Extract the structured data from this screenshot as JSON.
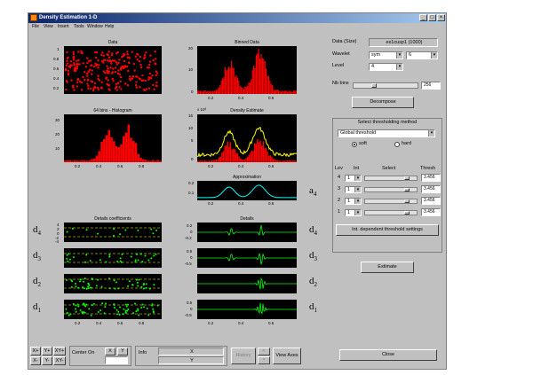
{
  "window": {
    "title": "Density Estimation 1-D"
  },
  "menus": [
    "File",
    "View",
    "Insert",
    "Tools",
    "Window",
    "Help"
  ],
  "plots": {
    "data_title": "Data",
    "binned_title": "Binned Data",
    "hist_title": "64 bins - Histogram",
    "density_title": "Density Estimate",
    "density_exp": "x 10³",
    "approx_title": "Approximation",
    "details_coef_title": "Details coefficients",
    "details_title": "Details"
  },
  "ticks": {
    "data_y": [
      "1",
      "0.8",
      "0.6",
      "0.4",
      "0.2"
    ],
    "binned_y": [
      "20",
      "10",
      "0"
    ],
    "binned_x": [
      "0.2",
      "0.4",
      "0.6"
    ],
    "hist_y": [
      "30",
      "20",
      "10"
    ],
    "hist_x": [
      "0.2",
      "0.4",
      "0.6",
      "0.8"
    ],
    "density_y": [
      "15",
      "10",
      "5",
      "0"
    ],
    "density_x": [
      "0.2",
      "0.4",
      "0.6"
    ],
    "approx_y": [
      "0.2",
      "0.1"
    ],
    "approx_x": [
      "0.2",
      "0.4",
      "0.6"
    ],
    "bottom_x_left": [
      "0.2",
      "0.4",
      "0.6",
      "0.8"
    ],
    "bottom_x_right": [
      "0.2",
      "0.4",
      "0.6"
    ],
    "d4_left_y": [
      "4",
      "2",
      "0",
      "-2",
      "-4"
    ],
    "d4_right_y": [
      "0.2",
      "0",
      "-0.2"
    ],
    "d3_right_y": [
      "0.5",
      "0",
      "-0.5"
    ],
    "d1_right_y": [
      "0.5",
      "0",
      "-0.5"
    ]
  },
  "dlabels": [
    "d",
    "d",
    "d",
    "d"
  ],
  "dsubs": [
    "4",
    "3",
    "2",
    "1"
  ],
  "approx_label": {
    "main": "a",
    "sub": "4"
  },
  "controls": {
    "data_size_label": "Data  (Size)",
    "data_size_value": "ex1cusp1  (1000)",
    "wavelet_label": "Wavelet",
    "wavelet_family": "sym",
    "wavelet_number": "6",
    "level_label": "Level",
    "level_value": "4",
    "nb_bins_label": "Nb bins",
    "nb_bins_value": "256",
    "decompose": "Decompose",
    "thresh_method_title": "Select thresholding method",
    "thresh_method": "Global threshold",
    "soft": "soft",
    "hard": "hard",
    "col_level": "Lev",
    "col_int": "Int",
    "col_select": "Select",
    "col_thresh": "Thresh",
    "levels": [
      {
        "lev": "4",
        "int": "1",
        "thresh": "3.456"
      },
      {
        "lev": "3",
        "int": "1",
        "thresh": "3.456"
      },
      {
        "lev": "2",
        "int": "1",
        "thresh": "3.456"
      },
      {
        "lev": "1",
        "int": "1",
        "thresh": "3.456"
      }
    ],
    "int_dependent": "Int. dependent threshold settings",
    "estimate": "Estimate",
    "close": "Close"
  },
  "bottom": {
    "x_plus": "X+",
    "y_plus": "Y+",
    "xy_plus": "XY+",
    "x_minus": "X-",
    "y_minus": "Y-",
    "xy_minus": "XY-",
    "center_on": "Center On",
    "center_x": "X",
    "center_y": "Y",
    "info": "Info",
    "info_x": "X",
    "info_y": "Y",
    "history": "History",
    "view_axes": "View Axes"
  },
  "colors": {
    "title_start": "#0a246a",
    "title_end": "#a6caf0",
    "red": "#ff0000",
    "green": "#00ff00",
    "yellow": "#ffff00",
    "cyan": "#00ffff"
  }
}
